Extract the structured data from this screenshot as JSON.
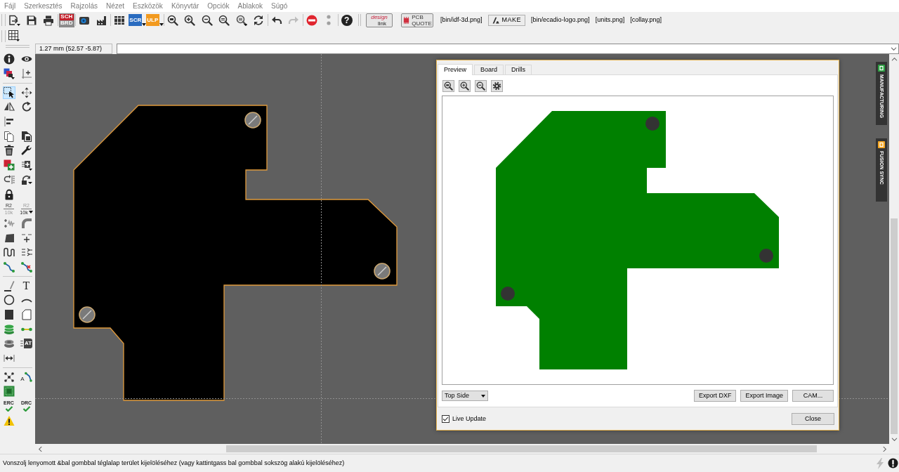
{
  "menu_bar": {
    "items": [
      "Fájl",
      "Szerkesztés",
      "Rajzolás",
      "Nézet",
      "Eszközök",
      "Könyvtár",
      "Opciók",
      "Ablakok",
      "Súgó"
    ]
  },
  "toolbar": {
    "board_switch": [
      {
        "label": "SCH",
        "selected": true
      },
      {
        "label": "BRD",
        "selected": false
      }
    ],
    "script_label": "SCR",
    "ulp_label": "ULP",
    "redo": {
      "disabled": true
    },
    "help_label": "?",
    "extensions": [
      {
        "kind": "logo",
        "lines": [
          "design",
          "link"
        ]
      },
      {
        "kind": "quote",
        "lines": [
          "PCB",
          "QUOTE"
        ]
      },
      {
        "kind": "text",
        "label": "[bin/idf-3d.png]"
      },
      {
        "kind": "make",
        "label": "MAKE"
      },
      {
        "kind": "text",
        "label": "[bin/ecadio-logo.png]"
      },
      {
        "kind": "text",
        "label": "[units.png]"
      },
      {
        "kind": "text",
        "label": "[collay.png]"
      }
    ]
  },
  "coordinate_display": "1.27 mm (52.57 -5.87)",
  "tool_palette": {
    "groups": [
      {
        "tools": [
          {
            "selected": false
          },
          {
            "selected": false
          },
          {
            "selected": false
          },
          {
            "selected": false
          }
        ]
      },
      {
        "tools": [
          {
            "selected": true
          },
          {
            "selected": false
          },
          {
            "selected": false
          },
          {
            "selected": false
          },
          {
            "selected": false
          },
          {
            "selected": false
          },
          {
            "selected": false
          },
          {
            "selected": false
          },
          {
            "selected": false
          },
          {
            "selected": false
          },
          {
            "selected": false
          },
          {
            "selected": false
          },
          {
            "selected": false
          },
          {
            "selected": false
          },
          {
            "selected": false,
            "lines": [
              "R2",
              "10k"
            ]
          },
          {
            "selected": false,
            "lines": [
              "R2",
              "10k"
            ]
          },
          {
            "selected": false
          },
          {
            "selected": false
          },
          {
            "selected": false
          },
          {
            "selected": false
          },
          {
            "selected": false
          },
          {
            "selected": false
          },
          {
            "selected": false
          },
          {
            "selected": false
          }
        ]
      },
      {
        "tools": [
          {
            "selected": false
          },
          {
            "selected": false,
            "label": "T"
          },
          {
            "selected": false
          },
          {
            "selected": false
          },
          {
            "selected": false
          },
          {
            "selected": false
          },
          {
            "selected": false
          },
          {
            "selected": false
          },
          {
            "selected": false
          },
          {
            "selected": false,
            "label": "AT"
          },
          {
            "selected": false
          }
        ]
      },
      {
        "tools": [
          {
            "selected": false
          },
          {
            "selected": false,
            "label": "A"
          },
          {
            "selected": false
          },
          {
            "selected": false,
            "label": "ERC"
          },
          {
            "selected": false,
            "label": "DRC"
          },
          {
            "selected": false
          }
        ]
      }
    ]
  },
  "side_tabs": [
    {
      "label": "MANUFACTURING",
      "color": "#2ea043"
    },
    {
      "label": "FUSION SYNC",
      "color": "#f5a623"
    }
  ],
  "preview_dialog": {
    "tabs": [
      {
        "label": "Preview",
        "selected": true
      },
      {
        "label": "Board",
        "selected": false
      },
      {
        "label": "Drills",
        "selected": false
      }
    ],
    "side_select": "Top Side",
    "buttons": [
      "Export DXF",
      "Export Image",
      "CAM..."
    ],
    "live_update": {
      "label": "Live Update",
      "checked": true
    },
    "close_label": "Close"
  },
  "status_bar": {
    "message": "Vonszolj lenyomott &bal gombbal téglalap terület kijelöléséhez (vagy kattintgass bal gombbal sokszög alakú kijelöléséhez)"
  }
}
